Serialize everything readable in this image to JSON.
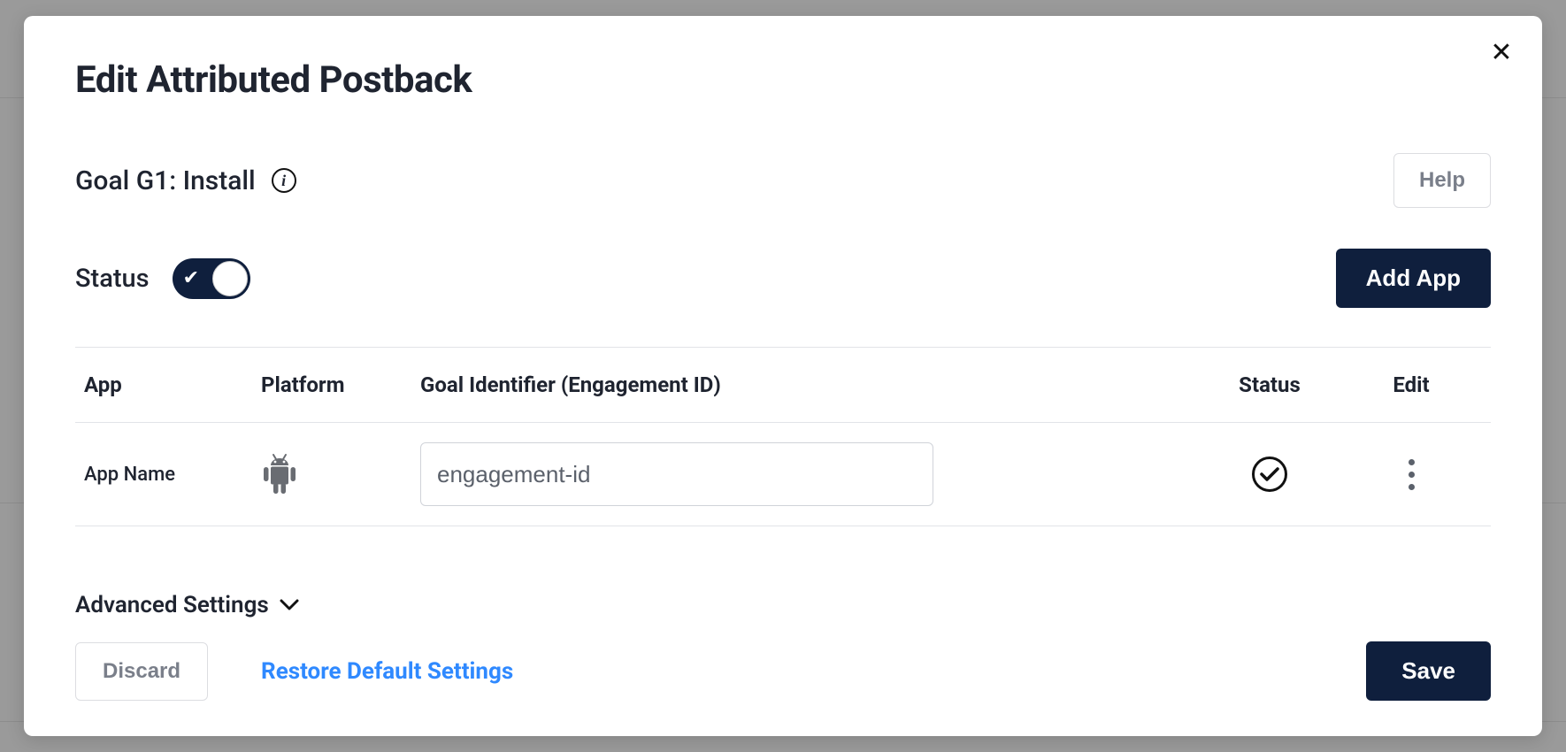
{
  "modal": {
    "title": "Edit Attributed Postback",
    "goal_label": "Goal G1: Install",
    "status_label": "Status",
    "help_label": "Help",
    "add_app_label": "Add App",
    "advanced_label": "Advanced Settings",
    "status_on": true
  },
  "table": {
    "headers": {
      "app": "App",
      "platform": "Platform",
      "goal_id": "Goal Identifier (Engagement ID)",
      "status": "Status",
      "edit": "Edit"
    },
    "rows": [
      {
        "app": "App Name",
        "platform": "android",
        "goal_identifier": "engagement-id",
        "status_ok": true
      }
    ]
  },
  "footer": {
    "discard": "Discard",
    "restore": "Restore Default Settings",
    "save": "Save"
  }
}
